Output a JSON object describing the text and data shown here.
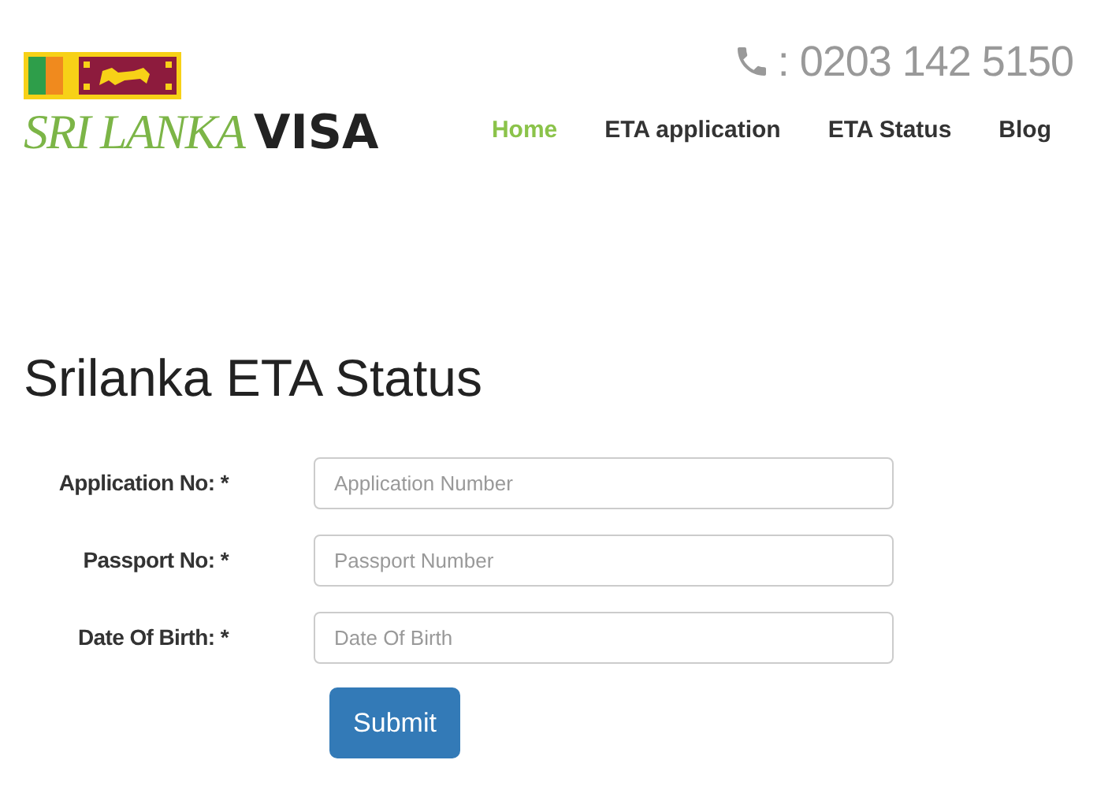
{
  "logo": {
    "part_1": "SRI LANKA",
    "part_2": "VISA"
  },
  "phone": ": 0203 142 5150",
  "nav": [
    {
      "label": "Home",
      "selected": true
    },
    {
      "label": "ETA application",
      "selected": false
    },
    {
      "label": "ETA Status",
      "selected": false
    },
    {
      "label": "Blog",
      "selected": false
    }
  ],
  "title": "Srilanka ETA Status",
  "fields": [
    {
      "label": "Application No: *",
      "placeholder": "Application Number"
    },
    {
      "label": "Passport No: *",
      "placeholder": "Passport Number"
    },
    {
      "label": "Date Of Birth: *",
      "placeholder": "Date Of Birth"
    }
  ],
  "submit": "Submit"
}
